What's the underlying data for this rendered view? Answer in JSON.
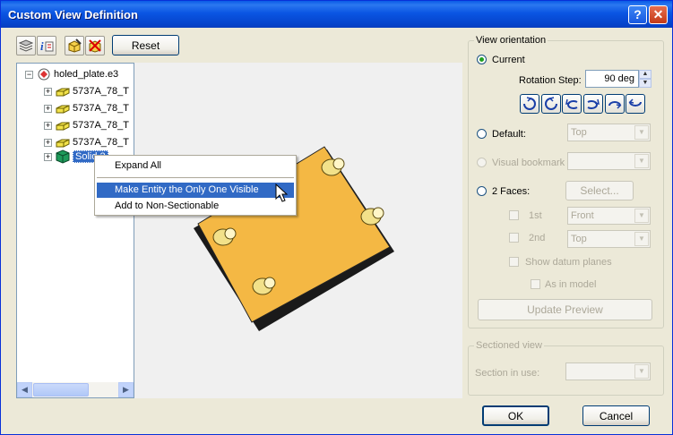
{
  "window": {
    "title": "Custom View Definition",
    "help_glyph": "?",
    "close_glyph": "✕"
  },
  "toolbar": {
    "icons": [
      "layers-icon",
      "info-icon",
      "box-pen-icon",
      "hide-entity-icon"
    ],
    "reset_label": "Reset"
  },
  "tree": {
    "root": {
      "label": "holed_plate.e3",
      "expander": "−"
    },
    "children": [
      {
        "label": "5737A_78_T",
        "expander": "+"
      },
      {
        "label": "5737A_78_T",
        "expander": "+"
      },
      {
        "label": "5737A_78_T",
        "expander": "+"
      },
      {
        "label": "5737A_78_T",
        "expander": "+"
      },
      {
        "label": "Solid 2",
        "expander": "+"
      }
    ],
    "scroll_left": "◀",
    "scroll_right": "▶"
  },
  "context_menu": {
    "items": [
      "Expand All",
      "Make Entity the Only One Visible",
      "Add to Non-Sectionable"
    ],
    "highlighted_index": 1
  },
  "view_orientation": {
    "title": "View orientation",
    "current_label": "Current",
    "rotation_step_label": "Rotation Step:",
    "rotation_step_value": "90 deg",
    "spin_up": "▲",
    "spin_down": "▼",
    "default_label": "Default:",
    "default_value": "Top",
    "visual_bookmark_label": "Visual bookmark",
    "visual_bookmark_value": "",
    "two_faces_label": "2 Faces:",
    "select_label": "Select...",
    "first_label": "1st",
    "first_value": "Front",
    "second_label": "2nd",
    "second_value": "Top",
    "show_datum_label": "Show datum planes",
    "as_in_model_label": "As in model",
    "update_preview_label": "Update Preview",
    "combo_arrow": "▼"
  },
  "sectioned_view": {
    "title": "Sectioned view",
    "section_in_use_label": "Section in use:",
    "section_value": ""
  },
  "footer": {
    "ok_label": "OK",
    "cancel_label": "Cancel"
  },
  "colors": {
    "plate": "#f4b844",
    "bolt": "#f2e18a",
    "selection": "#316ac5",
    "title_bar": "#0a55e3"
  }
}
